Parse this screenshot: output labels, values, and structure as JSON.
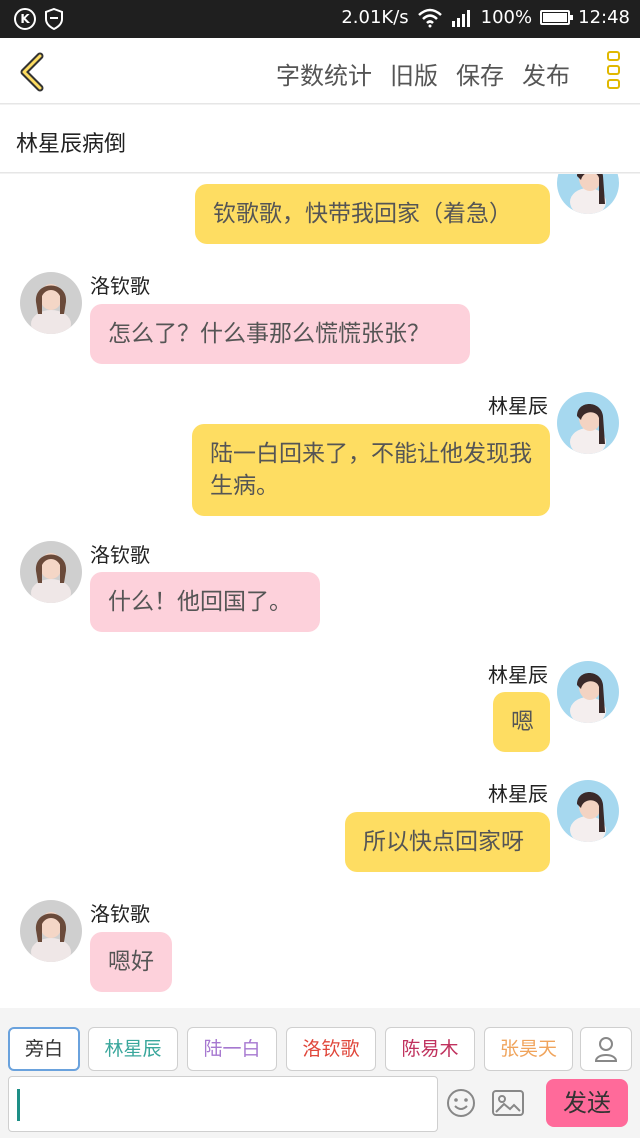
{
  "status_bar": {
    "network_speed": "2.01K/s",
    "battery": "100%",
    "battery_level": 1.0,
    "time": "12:48"
  },
  "toolbar": {
    "word_count": "字数统计",
    "old_version": "旧版",
    "save": "保存",
    "publish": "发布"
  },
  "story": {
    "title": "林星辰病倒"
  },
  "messages": [
    {
      "side": "right",
      "speaker": "",
      "text": "钦歌歌，快带我回家（着急）"
    },
    {
      "side": "left",
      "speaker": "洛钦歌",
      "text": "怎么了？什么事那么慌慌张张？"
    },
    {
      "side": "right",
      "speaker": "林星辰",
      "text": "陆一白回来了，不能让他发现我生病。"
    },
    {
      "side": "left",
      "speaker": "洛钦歌",
      "text": "什么！他回国了。"
    },
    {
      "side": "right",
      "speaker": "林星辰",
      "text": "嗯"
    },
    {
      "side": "right",
      "speaker": "林星辰",
      "text": "所以快点回家呀"
    },
    {
      "side": "left",
      "speaker": "洛钦歌",
      "text": "嗯好"
    }
  ],
  "roles": [
    {
      "label": "旁白",
      "color": "#333333",
      "selected": true
    },
    {
      "label": "林星辰",
      "color": "#3aa79c"
    },
    {
      "label": "陆一白",
      "color": "#a678d0"
    },
    {
      "label": "洛钦歌",
      "color": "#e0483c"
    },
    {
      "label": "陈易木",
      "color": "#c0325e"
    },
    {
      "label": "张昊天",
      "color": "#f0a45c"
    }
  ],
  "composer": {
    "send_label": "发送"
  },
  "colors": {
    "yellow_bubble": "#fedd62",
    "pink_bubble": "#fdd1db",
    "send_button": "#ff6a9a",
    "accent": "#e0b800"
  }
}
